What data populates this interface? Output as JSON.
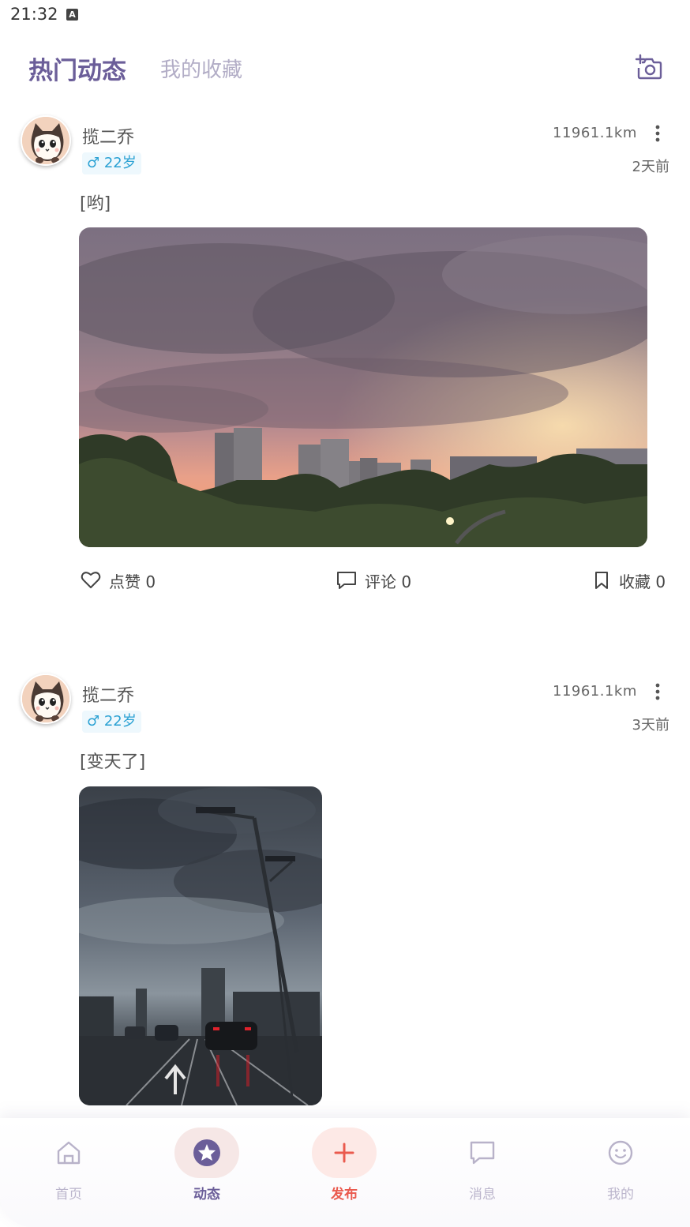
{
  "status_bar": {
    "time": "21:32",
    "indicator": "A"
  },
  "header": {
    "tab_hot": "热门动态",
    "tab_favorites": "我的收藏",
    "camera_icon": "camera-add-icon"
  },
  "posts": [
    {
      "username": "揽二乔",
      "gender_age": "♂ 22岁",
      "distance": "11961.1km",
      "time_ago": "2天前",
      "text": "[哟]",
      "image": "sunset-city-skyline-photo",
      "like_label": "点赞 0",
      "comment_label": "评论 0",
      "collect_label": "收藏 0"
    },
    {
      "username": "揽二乔",
      "gender_age": "♂ 22岁",
      "distance": "11961.1km",
      "time_ago": "3天前",
      "text": "[变天了]",
      "image": "stormy-street-photo"
    }
  ],
  "bottom_nav": {
    "items": [
      {
        "label": "首页",
        "icon": "home-icon",
        "active": false
      },
      {
        "label": "动态",
        "icon": "star-icon",
        "active": true
      },
      {
        "label": "发布",
        "icon": "plus-icon",
        "active": false
      },
      {
        "label": "消息",
        "icon": "message-icon",
        "active": false
      },
      {
        "label": "我的",
        "icon": "smile-icon",
        "active": false
      }
    ]
  },
  "colors": {
    "accent_purple": "#6b5e99",
    "inactive_tab": "#b2adc6",
    "gender_blue": "#2aa1d3",
    "publish_red": "#ea5a4e"
  }
}
